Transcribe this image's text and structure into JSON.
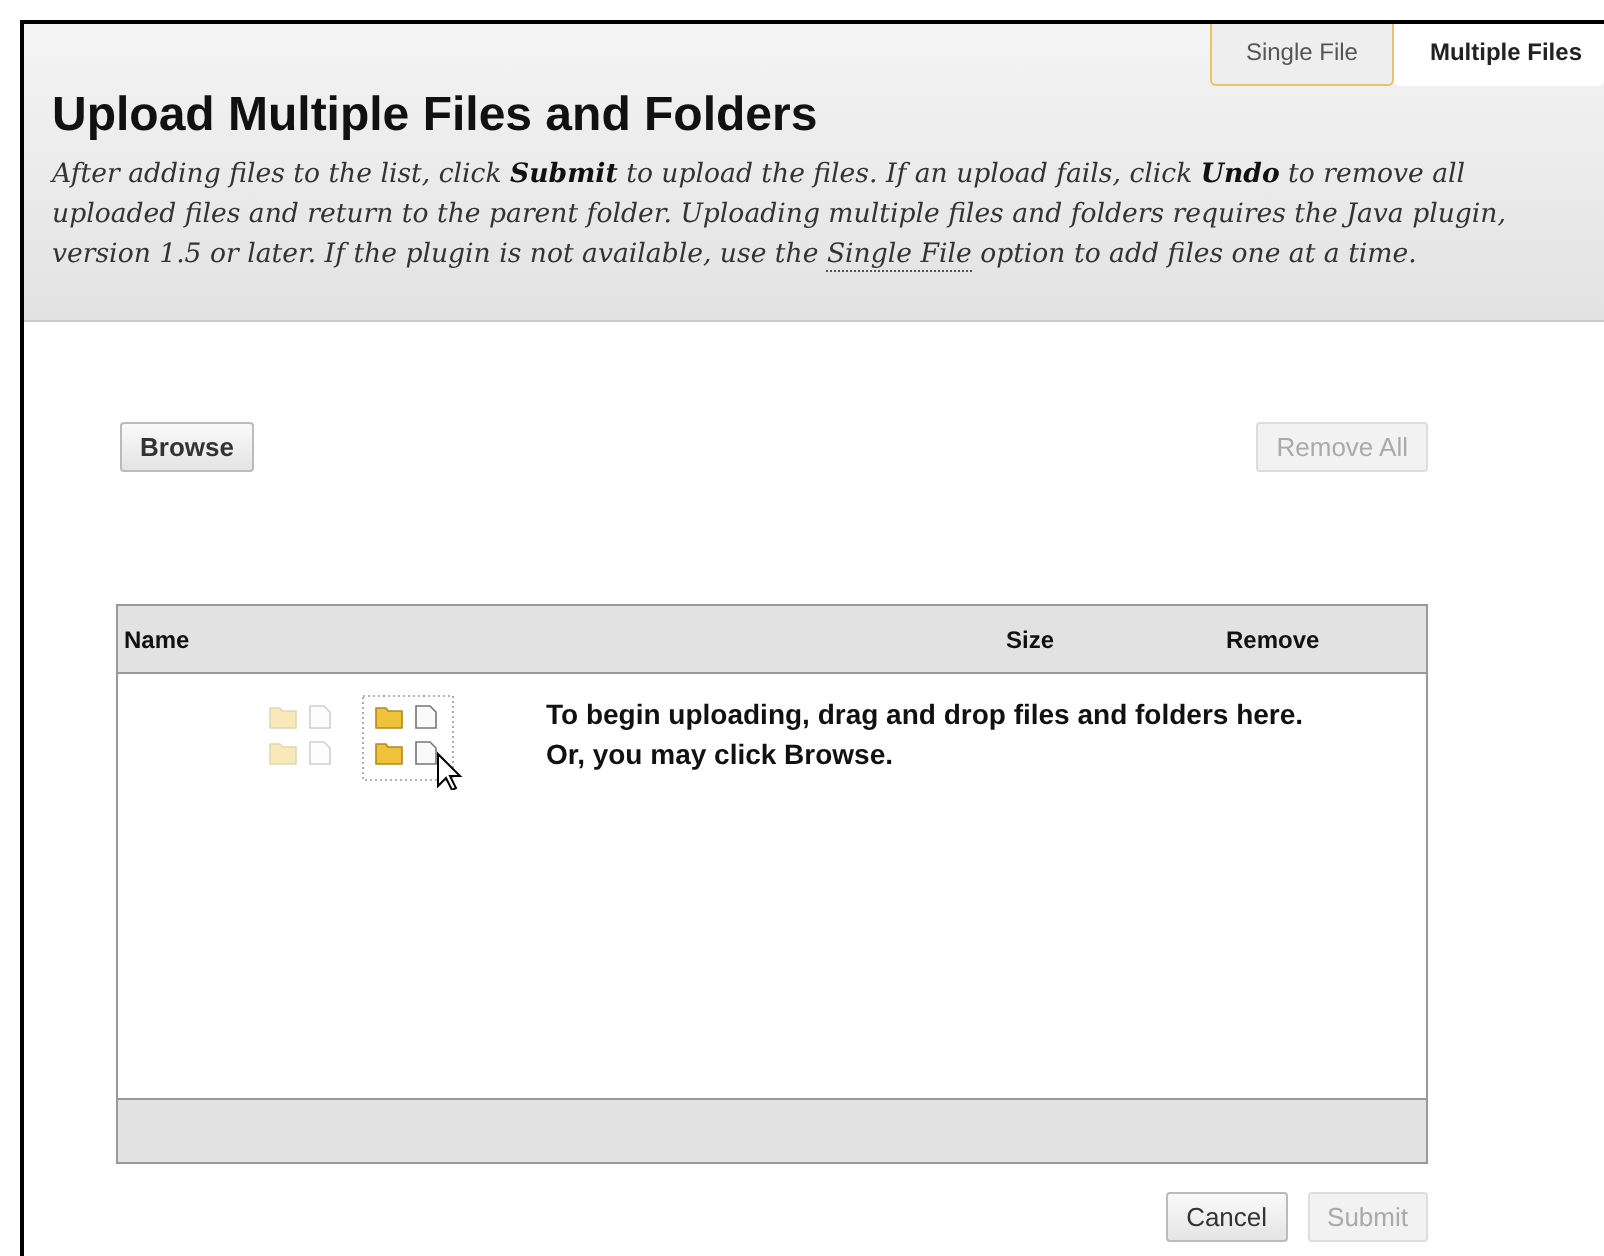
{
  "tabs": [
    {
      "label": "Single File",
      "selected": false
    },
    {
      "label": "Multiple Files",
      "selected": true
    }
  ],
  "title": "Upload Multiple Files and Folders",
  "description": {
    "before": "After adding files to the list, click **Submit** to upload the files. If an upload fails, click **Undo** to remove all uploaded files and return to the parent folder. Uploading multiple files and folders requires the Java plugin, version 1.5 or later. If the plugin is not available, use the",
    "link": "Single File",
    "after": "option to add files one at a time."
  },
  "toolbar": [
    {
      "label": "Browse",
      "disabled": false
    },
    {
      "label": "Remove All",
      "disabled": true
    }
  ],
  "table": {
    "columns": [
      "Name",
      "Size",
      "Remove"
    ],
    "empty_message": [
      "To begin uploading, drag and drop files and folders here.",
      "Or, you may click Browse."
    ]
  },
  "buttons": [
    {
      "label": "Cancel",
      "disabled": false
    },
    {
      "label": "Submit",
      "disabled": true
    }
  ]
}
